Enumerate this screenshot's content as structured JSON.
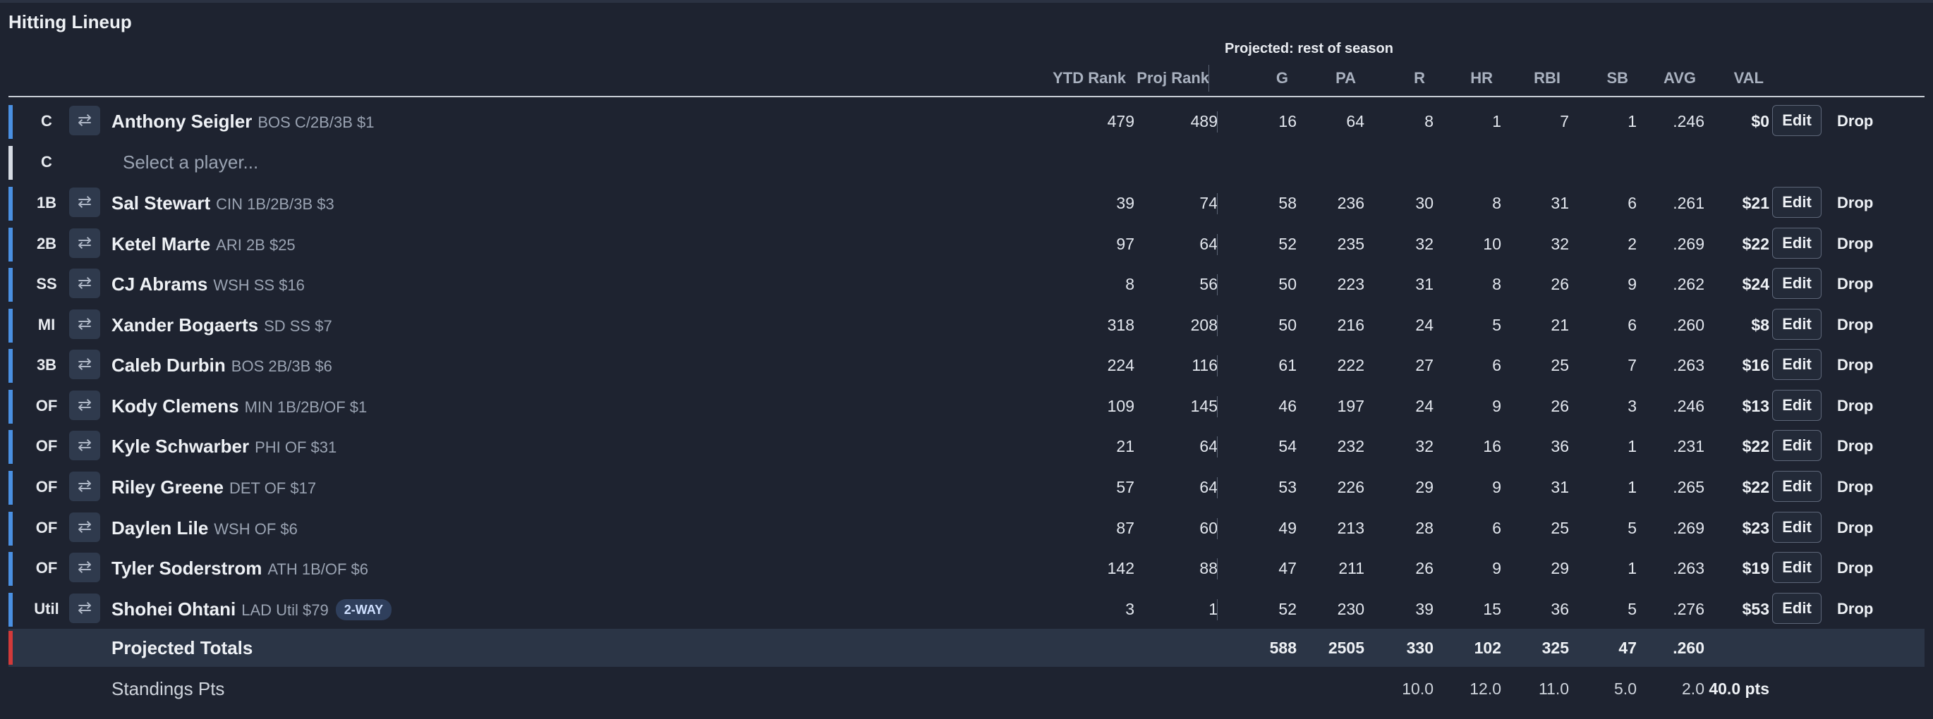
{
  "title": "Hitting Lineup",
  "projection_label": "Projected: rest of season",
  "columns": {
    "ytd_rank": "YTD Rank",
    "proj_rank": "Proj Rank",
    "g": "G",
    "pa": "PA",
    "r": "R",
    "hr": "HR",
    "rbi": "RBI",
    "sb": "SB",
    "avg": "AVG",
    "val": "VAL"
  },
  "buttons": {
    "edit": "Edit",
    "drop": "Drop",
    "swap_icon": "⇄"
  },
  "empty_slot": {
    "pos": "C",
    "placeholder": "Select a player..."
  },
  "rows": [
    {
      "pos": "C",
      "name": "Anthony Seigler",
      "meta": "BOS C/2B/3B $1",
      "ytd": "479",
      "proj": "489",
      "g": "16",
      "pa": "64",
      "r": "8",
      "hr": "1",
      "rbi": "7",
      "sb": "1",
      "avg": ".246",
      "val": "$0"
    },
    {
      "pos": "1B",
      "name": "Sal Stewart",
      "meta": "CIN 1B/2B/3B $3",
      "ytd": "39",
      "proj": "74",
      "g": "58",
      "pa": "236",
      "r": "30",
      "hr": "8",
      "rbi": "31",
      "sb": "6",
      "avg": ".261",
      "val": "$21"
    },
    {
      "pos": "2B",
      "name": "Ketel Marte",
      "meta": "ARI 2B $25",
      "ytd": "97",
      "proj": "64",
      "g": "52",
      "pa": "235",
      "r": "32",
      "hr": "10",
      "rbi": "32",
      "sb": "2",
      "avg": ".269",
      "val": "$22"
    },
    {
      "pos": "SS",
      "name": "CJ Abrams",
      "meta": "WSH SS $16",
      "ytd": "8",
      "proj": "56",
      "g": "50",
      "pa": "223",
      "r": "31",
      "hr": "8",
      "rbi": "26",
      "sb": "9",
      "avg": ".262",
      "val": "$24"
    },
    {
      "pos": "MI",
      "name": "Xander Bogaerts",
      "meta": "SD SS $7",
      "ytd": "318",
      "proj": "208",
      "g": "50",
      "pa": "216",
      "r": "24",
      "hr": "5",
      "rbi": "21",
      "sb": "6",
      "avg": ".260",
      "val": "$8"
    },
    {
      "pos": "3B",
      "name": "Caleb Durbin",
      "meta": "BOS 2B/3B $6",
      "ytd": "224",
      "proj": "116",
      "g": "61",
      "pa": "222",
      "r": "27",
      "hr": "6",
      "rbi": "25",
      "sb": "7",
      "avg": ".263",
      "val": "$16"
    },
    {
      "pos": "OF",
      "name": "Kody Clemens",
      "meta": "MIN 1B/2B/OF $1",
      "ytd": "109",
      "proj": "145",
      "g": "46",
      "pa": "197",
      "r": "24",
      "hr": "9",
      "rbi": "26",
      "sb": "3",
      "avg": ".246",
      "val": "$13"
    },
    {
      "pos": "OF",
      "name": "Kyle Schwarber",
      "meta": "PHI OF $31",
      "ytd": "21",
      "proj": "64",
      "g": "54",
      "pa": "232",
      "r": "32",
      "hr": "16",
      "rbi": "36",
      "sb": "1",
      "avg": ".231",
      "val": "$22"
    },
    {
      "pos": "OF",
      "name": "Riley Greene",
      "meta": "DET OF $17",
      "ytd": "57",
      "proj": "64",
      "g": "53",
      "pa": "226",
      "r": "29",
      "hr": "9",
      "rbi": "31",
      "sb": "1",
      "avg": ".265",
      "val": "$22"
    },
    {
      "pos": "OF",
      "name": "Daylen Lile",
      "meta": "WSH OF $6",
      "ytd": "87",
      "proj": "60",
      "g": "49",
      "pa": "213",
      "r": "28",
      "hr": "6",
      "rbi": "25",
      "sb": "5",
      "avg": ".269",
      "val": "$23"
    },
    {
      "pos": "OF",
      "name": "Tyler Soderstrom",
      "meta": "ATH 1B/OF $6",
      "ytd": "142",
      "proj": "88",
      "g": "47",
      "pa": "211",
      "r": "26",
      "hr": "9",
      "rbi": "29",
      "sb": "1",
      "avg": ".263",
      "val": "$19"
    },
    {
      "pos": "Util",
      "name": "Shohei Ohtani",
      "meta": "LAD Util $79",
      "badge": "2-WAY",
      "ytd": "3",
      "proj": "1",
      "g": "52",
      "pa": "230",
      "r": "39",
      "hr": "15",
      "rbi": "36",
      "sb": "5",
      "avg": ".276",
      "val": "$53"
    }
  ],
  "totals": {
    "label": "Projected Totals",
    "g": "588",
    "pa": "2505",
    "r": "330",
    "hr": "102",
    "rbi": "325",
    "sb": "47",
    "avg": ".260"
  },
  "standings": {
    "label": "Standings Pts",
    "r": "10.0",
    "hr": "12.0",
    "rbi": "11.0",
    "sb": "5.0",
    "avg": "2.0",
    "total": "40.0 pts"
  },
  "colors": {
    "background": "#1e2330",
    "filled_slot_bar": "#4a90e2",
    "empty_slot_bar": "#d6dbe3",
    "totals_bar": "#d23a3a"
  }
}
